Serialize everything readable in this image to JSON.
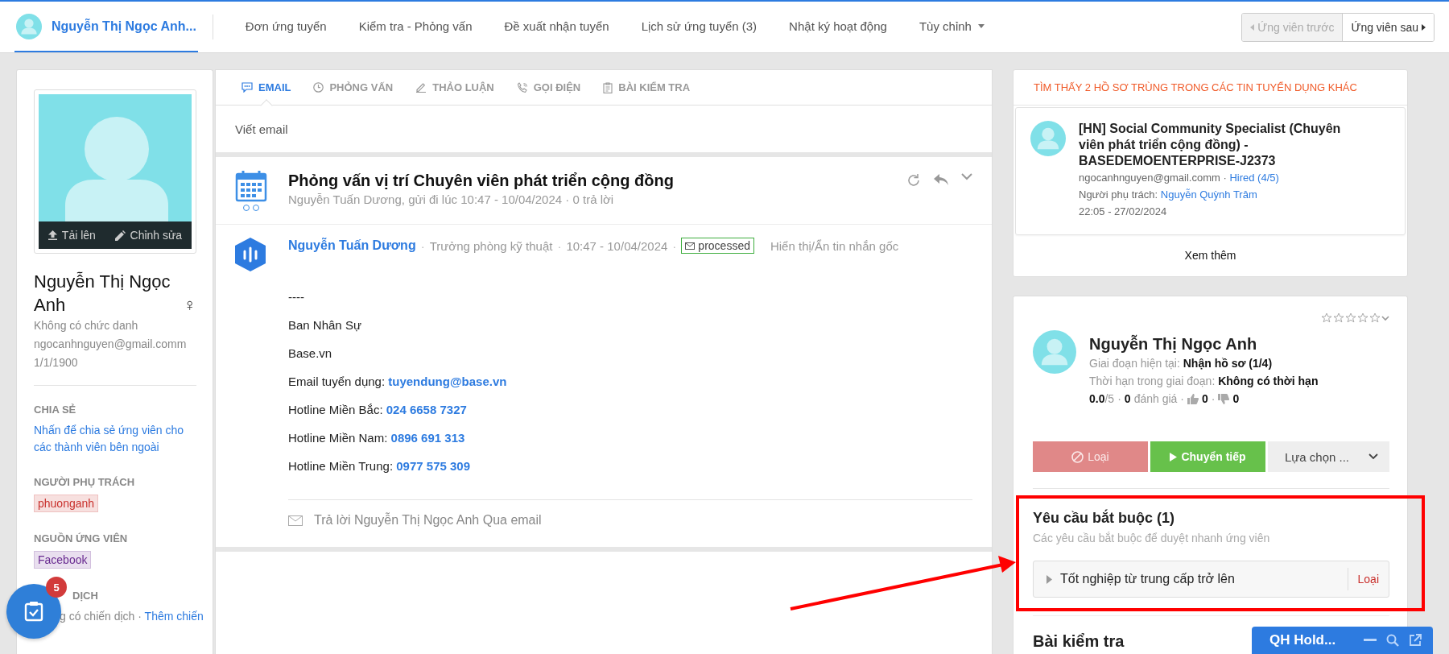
{
  "topbar": {
    "tabs": [
      {
        "kind": "candidate",
        "label": "Nguyễn Thị Ngọc Anh...",
        "selected": true
      },
      {
        "kind": "plain",
        "label": "Đơn ứng tuyển",
        "selected": false
      },
      {
        "kind": "plain",
        "label": "Kiểm tra - Phỏng vấn",
        "selected": false
      },
      {
        "kind": "plain",
        "label": "Đề xuất nhận tuyển",
        "selected": false
      },
      {
        "kind": "plain",
        "label": "Lịch sử ứng tuyển (3)",
        "selected": false
      },
      {
        "kind": "plain",
        "label": "Nhật ký hoạt động",
        "selected": false
      },
      {
        "kind": "dropdown",
        "label": "Tùy chỉnh",
        "selected": false
      }
    ],
    "nav": [
      {
        "kind": "prev",
        "label": "Ứng viên trước",
        "disabled": true
      },
      {
        "kind": "next",
        "label": "Ứng viên sau",
        "disabled": false
      }
    ]
  },
  "profile": {
    "photo_actions": [
      "Tải lên",
      "Chỉnh sửa"
    ],
    "name": "Nguyễn Thị Ngọc Anh",
    "gender": "♀",
    "job_title": "Không có chức danh",
    "email": "ngocanhnguyen@gmail.comm",
    "birthday": "1/1/1900",
    "sections": [
      {
        "kind": "link",
        "heading": "CHIA SẺ",
        "text": "Nhấn để chia sẻ ứng viên cho các thành viên bên ngoài"
      },
      {
        "kind": "tag",
        "heading": "NGƯỜI PHỤ TRÁCH",
        "text": "phuonganh",
        "color": "#c9302c"
      },
      {
        "kind": "tag",
        "heading": "NGUỒN ỨNG VIÊN",
        "text": "Facebook",
        "color": "#6a2c91"
      },
      {
        "kind": "campaign",
        "heading": "DỊCH",
        "text": "g có chiến dịch ·",
        "link": "Thêm chiến"
      }
    ]
  },
  "tasks_button": {
    "badge": "5"
  },
  "activity": {
    "tabs": [
      {
        "label": "EMAIL",
        "selected": true
      },
      {
        "label": "PHỎNG VẤN",
        "selected": false
      },
      {
        "label": "THẢO LUẬN",
        "selected": false
      },
      {
        "label": "GỌI ĐIỆN",
        "selected": false
      },
      {
        "label": "BÀI KIỂM TRA",
        "selected": false
      }
    ],
    "compose": {
      "placeholder": "Viết email"
    },
    "thread": {
      "title": "Phỏng vấn vị trí Chuyên viên phát triển cộng đồng",
      "meta": "Nguyễn Tuấn Dương, gửi đi lúc 10:47 - 10/04/2024 · 0 trả lời",
      "message": {
        "separators": [
          "·",
          "·",
          "·"
        ],
        "sender": "Nguyễn Tuấn Dương",
        "role": "Trưởng phòng kỹ thuật",
        "time": "10:47 - 10/04/2024",
        "status": "processed",
        "toggle": "Hiển thị/Ẩn tin nhắn gốc",
        "body": [
          {
            "text": "----"
          },
          {
            "text": "Ban Nhân Sự"
          },
          {
            "text": "Base.vn"
          },
          {
            "label": "Email tuyển dụng:",
            "value": "tuyendung@base.vn"
          },
          {
            "label": "Hotline Miền Bắc:",
            "value": "024 6658 7327"
          },
          {
            "label": "Hotline Miền Nam:",
            "value": "0896 691 313"
          },
          {
            "label": "Hotline Miền Trung:",
            "value": "0977 575 309"
          }
        ]
      },
      "reply": "Trả lời Nguyễn Thị Ngọc Anh Qua email"
    }
  },
  "duplicates": {
    "heading": "TÌM THẤY 2 HỒ SƠ TRÙNG TRONG CÁC TIN TUYỂN DỤNG KHÁC",
    "items": [
      {
        "title": "[HN] Social Community Specialist (Chuyên viên phát triển cộng đồng) - BASEDEMOENTERPRISE-J2373",
        "email": "ngocanhnguyen@gmail.comm",
        "separator": "·",
        "stage": "Hired (4/5)",
        "owner_label": "Người phụ trách:",
        "owner": "Nguyễn Quỳnh Trâm",
        "time": "22:05 - 27/02/2024"
      }
    ],
    "more": "Xem thêm"
  },
  "candidate": {
    "stars": 0,
    "name": "Nguyễn Thị Ngọc Anh",
    "stage_label": "Giai đoạn hiện tại:",
    "stage": "Nhận hồ sơ (1/4)",
    "deadline_label": "Thời hạn trong giai đoạn:",
    "deadline": "Không có thời hạn",
    "score": "0.0",
    "score_max": "/5",
    "reviews": "0",
    "reviews_label": "đánh giá",
    "separators": [
      "·",
      "·",
      "·"
    ],
    "likes": "0",
    "dislikes": "0",
    "actions": [
      {
        "kind": "reject",
        "label": "Loại"
      },
      {
        "kind": "advance",
        "label": "Chuyển tiếp"
      },
      {
        "kind": "menu",
        "label": "Lựa chọn ..."
      }
    ],
    "requirements": {
      "title": "Yêu cầu bắt buộc (1)",
      "subtitle": "Các yêu cầu bắt buộc để duyệt nhanh ứng viên",
      "items": [
        {
          "text": "Tốt nghiệp từ trung cấp trở lên",
          "action": "Loại",
          "expanded": false
        }
      ]
    },
    "tests_title": "Bài kiểm tra"
  },
  "chat": {
    "title": "QH Hold..."
  }
}
